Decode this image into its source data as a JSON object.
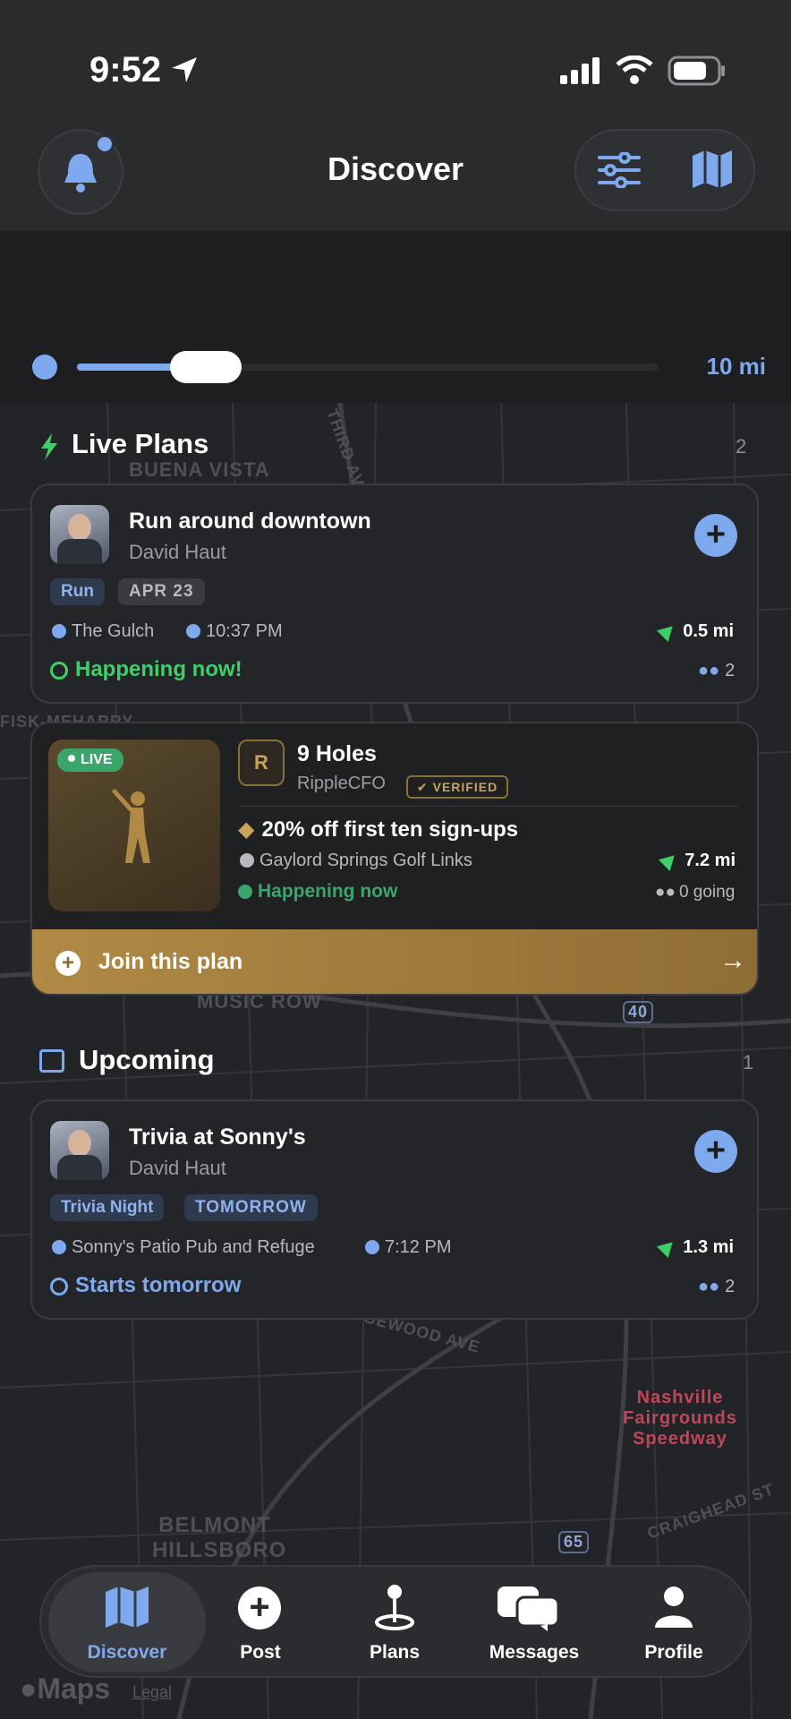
{
  "status_bar": {
    "time": "9:52"
  },
  "header": {
    "title": "Discover"
  },
  "radius": {
    "value": "10 mi",
    "fraction": 0.2
  },
  "live_section": {
    "title": "Live Plans",
    "count": "2"
  },
  "live_plans": [
    {
      "title": "Run around downtown",
      "host": "David Haut",
      "tags": [
        "Run",
        "APR 23"
      ],
      "location": "The Gulch",
      "time": "10:37 PM",
      "distance": "0.5 mi",
      "status": "Happening now!",
      "attendees": "2"
    }
  ],
  "featured": {
    "badge": "LIVE",
    "org_initial": "R",
    "title": "9 Holes",
    "org": "RippleCFO",
    "verified": "VERIFIED",
    "promo": "20% off first ten sign-ups",
    "location": "Gaylord Springs Golf Links",
    "distance": "7.2 mi",
    "status": "Happening now",
    "going": "0 going",
    "cta": "Join this plan"
  },
  "upcoming_section": {
    "title": "Upcoming",
    "count": "1"
  },
  "upcoming_plans": [
    {
      "title": "Trivia at Sonny's",
      "host": "David Haut",
      "tags": [
        "Trivia Night",
        "TOMORROW"
      ],
      "location": "Sonny's Patio Pub and Refuge",
      "time": "7:12 PM",
      "distance": "1.3 mi",
      "status": "Starts tomorrow",
      "attendees": "2"
    }
  ],
  "map_labels": [
    "BUENA VISTA",
    "THIRD AV",
    "MUSIC ROW",
    "FISK-MEHARRY",
    "Nashville",
    "Nashville Fairgrounds Speedway",
    "BELMONT HILLSBORO",
    "CRAIGHEAD ST",
    "WEDGEWOOD AVE",
    "40",
    "65"
  ],
  "tabs": [
    {
      "label": "Discover",
      "icon": "map-icon",
      "active": true
    },
    {
      "label": "Post",
      "icon": "plus-circle-icon"
    },
    {
      "label": "Plans",
      "icon": "pin-icon"
    },
    {
      "label": "Messages",
      "icon": "chat-bubbles-icon"
    },
    {
      "label": "Profile",
      "icon": "person-icon"
    }
  ],
  "map_watermark": "Maps",
  "legal": "Legal",
  "colors": {
    "accent": "#7fa9ee",
    "live_green": "#3ecf6a",
    "gold": "#b08a45"
  }
}
